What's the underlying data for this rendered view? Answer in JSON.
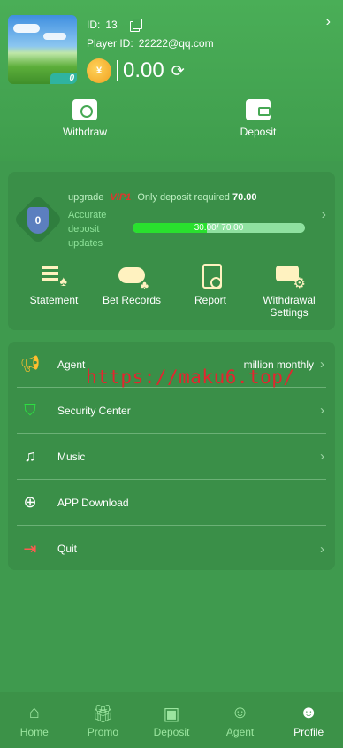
{
  "header": {
    "id_label": "ID:",
    "id_value": "13",
    "player_label": "Player ID:",
    "player_value": "22222@qq.com",
    "avatar_badge": "0",
    "balance": "0.00",
    "withdraw_label": "Withdraw",
    "deposit_label": "Deposit"
  },
  "vip": {
    "upgrade_text": "upgrade",
    "vip_level": "VIP1",
    "requirement_text": "Only deposit required",
    "required_amount": "70.00",
    "accurate_text": "Accurate deposit updates",
    "progress_text": "30.00/ 70.00",
    "progress_fraction": 0.43
  },
  "quick_actions": [
    {
      "label": "Statement"
    },
    {
      "label": "Bet Records"
    },
    {
      "label": "Report"
    },
    {
      "label": "Withdrawal Settings"
    }
  ],
  "menu": [
    {
      "label": "Agent",
      "extra": "million monthly"
    },
    {
      "label": "Security Center",
      "extra": ""
    },
    {
      "label": "Music",
      "extra": ""
    },
    {
      "label": "APP Download",
      "extra": ""
    },
    {
      "label": "Quit",
      "extra": ""
    }
  ],
  "watermark": "https://maku6.top/",
  "bottom_nav": [
    {
      "label": "Home"
    },
    {
      "label": "Promo"
    },
    {
      "label": "Deposit"
    },
    {
      "label": "Agent"
    },
    {
      "label": "Profile"
    }
  ],
  "colors": {
    "background": "#3f9a4e",
    "card": "#3a8f48",
    "progress_fill": "#29e02e",
    "vip_red": "#e0352d",
    "nav_inactive": "#9be59f"
  }
}
